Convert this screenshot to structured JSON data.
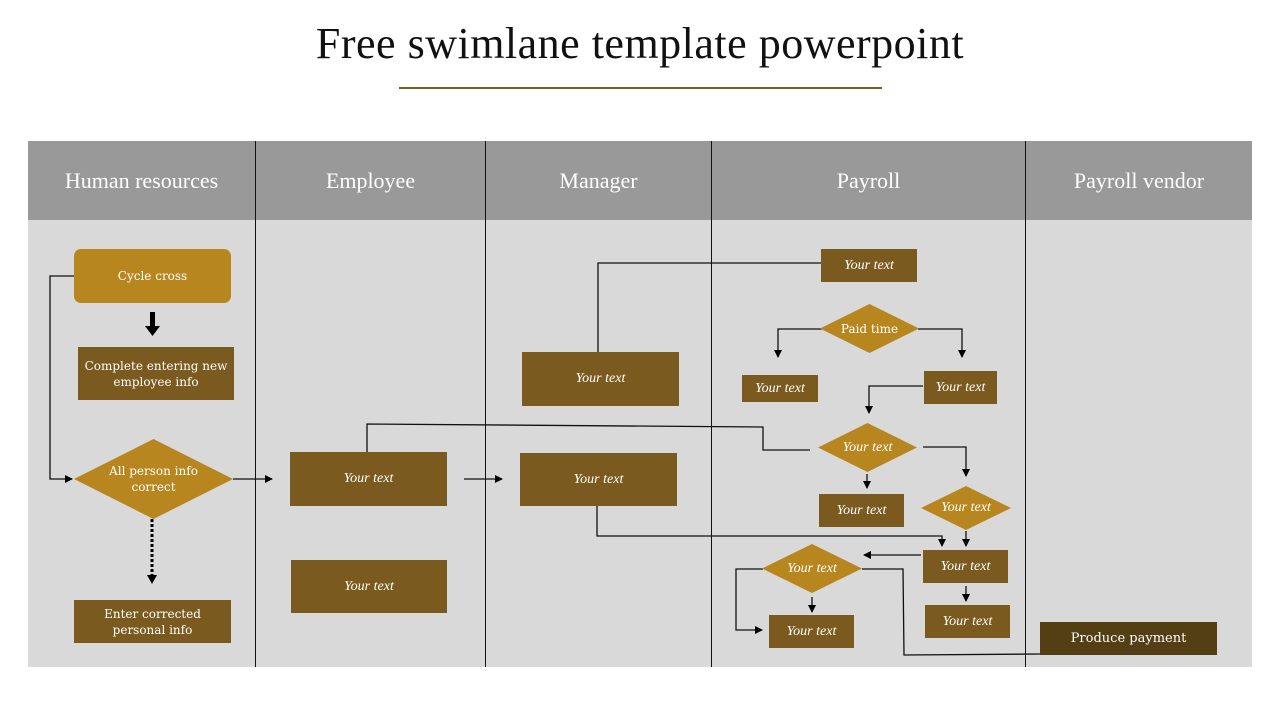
{
  "title": "Free swimlane template powerpoint",
  "colors": {
    "accent_light": "#b8861f",
    "accent_box": "#7b5a1f",
    "accent_dark": "#543f15",
    "header_bg": "#999999",
    "lane_bg": "#d9d9d9"
  },
  "lanes": [
    {
      "label": "Human resources"
    },
    {
      "label": "Employee"
    },
    {
      "label": "Manager"
    },
    {
      "label": "Payroll"
    },
    {
      "label": "Payroll vendor"
    }
  ],
  "nodes": {
    "hr_cycle_cross": "Cycle cross",
    "hr_complete_entering": "Complete entering new employee info",
    "hr_all_person_info": "All person info correct",
    "hr_enter_corrected": "Enter corrected personal info",
    "emp_box_1": "Your text",
    "emp_box_2": "Your text",
    "mgr_box_1": "Your text",
    "mgr_box_2": "Your text",
    "pay_top_box": "Your text",
    "pay_paid_time": "Paid time",
    "pay_left_box": "Your text",
    "pay_right_box": "Your text",
    "pay_decision_1": "Your text",
    "pay_box_below_decision_1": "Your text",
    "pay_decision_2": "Your text",
    "pay_box_mid_right": "Your text",
    "pay_box_bottom_right": "Your text",
    "pay_decision_3": "Your text",
    "pay_box_bottom_left": "Your text",
    "vendor_produce_payment": "Produce payment"
  }
}
